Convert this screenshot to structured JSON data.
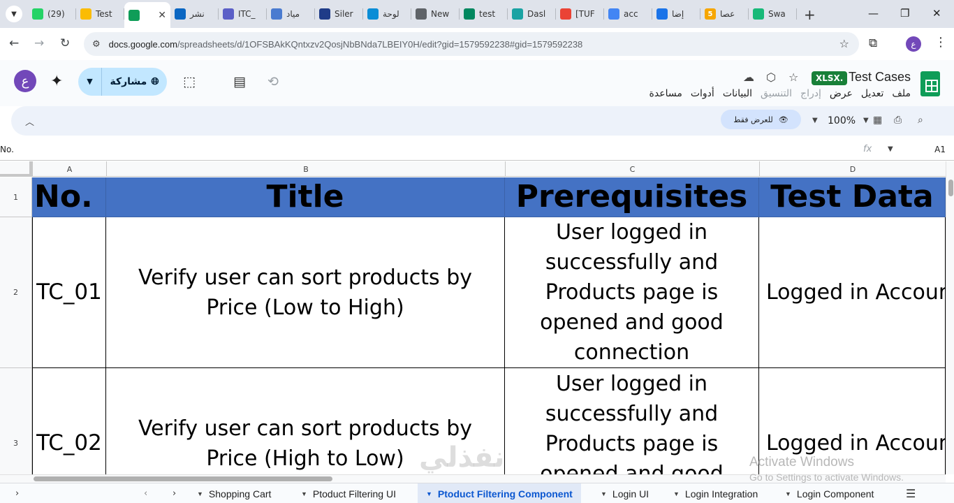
{
  "browser": {
    "tabs": [
      {
        "label": "(29)",
        "icon": "whatsapp-icon",
        "color": "#25d366"
      },
      {
        "label": "Test",
        "icon": "google-drive-icon",
        "color": "#fbbc04"
      },
      {
        "label": "",
        "icon": "google-sheets-icon",
        "color": "#0f9d58",
        "active": true
      },
      {
        "label": "نشر",
        "icon": "linkedin-icon",
        "color": "#0a66c2"
      },
      {
        "label": "ITC_",
        "icon": "teams-icon",
        "color": "#5b5fc7"
      },
      {
        "label": "مياد",
        "icon": "generic-icon",
        "color": "#4a7bd0"
      },
      {
        "label": "Siler",
        "icon": "generic-icon",
        "color": "#1f3c88"
      },
      {
        "label": "لوحة",
        "icon": "generic-icon",
        "color": "#0b8dd6"
      },
      {
        "label": "New",
        "icon": "chrome-icon",
        "color": "#5f6368"
      },
      {
        "label": "test",
        "icon": "play-icon",
        "color": "#01875f"
      },
      {
        "label": "Dasl",
        "icon": "generic-icon",
        "color": "#1aa3a3"
      },
      {
        "label": "[TUF",
        "icon": "gmail-icon",
        "color": "#ea4335"
      },
      {
        "label": "acc",
        "icon": "google-icon",
        "color": "#4285f4"
      },
      {
        "label": "إضا",
        "icon": "generic-icon",
        "color": "#1a73e8"
      },
      {
        "label": "عصا",
        "icon": "generic-icon",
        "color": "#f6a600",
        "glyph": "5"
      },
      {
        "label": "Swa",
        "icon": "generic-icon",
        "color": "#17b978"
      }
    ],
    "url_host": "docs.google.com",
    "url_path": "/spreadsheets/d/1OFSBAkKQntxzv2QosjNbBNda7LBEIY0H/edit?gid=1579592238#gid=1579592238",
    "profile_initial": "ع"
  },
  "sheets": {
    "title": "Test Cases",
    "badge": "XLSX.",
    "menu": [
      "ملف",
      "تعديل",
      "عرض",
      "إدراج",
      "التنسيق",
      "البيانات",
      "أدوات",
      "مساعدة"
    ],
    "share_label": "مشاركة",
    "avatar_initial": "ع",
    "view_only_label": "للعرض فقط",
    "zoom": "100%",
    "formula_content": "No.",
    "name_box": "A1"
  },
  "grid": {
    "columns": [
      "A",
      "B",
      "C",
      "D"
    ],
    "rows": [
      "1",
      "2",
      "3"
    ],
    "header": [
      "No.",
      "Title",
      "Prerequisites",
      "Test Data"
    ],
    "data": [
      [
        "TC_01",
        "Verify user can sort products by Price (Low to High)",
        "User logged in successfully and Products page is opened and good connection",
        "Logged in Account"
      ],
      [
        "TC_02",
        "Verify user can sort products by Price (High to Low)",
        "User logged in successfully and Products page is opened and good",
        "Logged in Account"
      ]
    ]
  },
  "colors": {
    "header_fill": "#4472c4",
    "share_button": "#c2e7ff"
  },
  "watermark": {
    "line1": "Activate Windows",
    "line2": "Go to Settings to activate Windows.",
    "logo_text": "نفذلي"
  },
  "sheet_tabs": [
    "Shopping Cart",
    "Ptoduct Filtering UI",
    "Ptoduct Filtering Component",
    "Login UI",
    "Login Integration",
    "Login Component"
  ],
  "active_sheet_tab": "Ptoduct Filtering Component"
}
